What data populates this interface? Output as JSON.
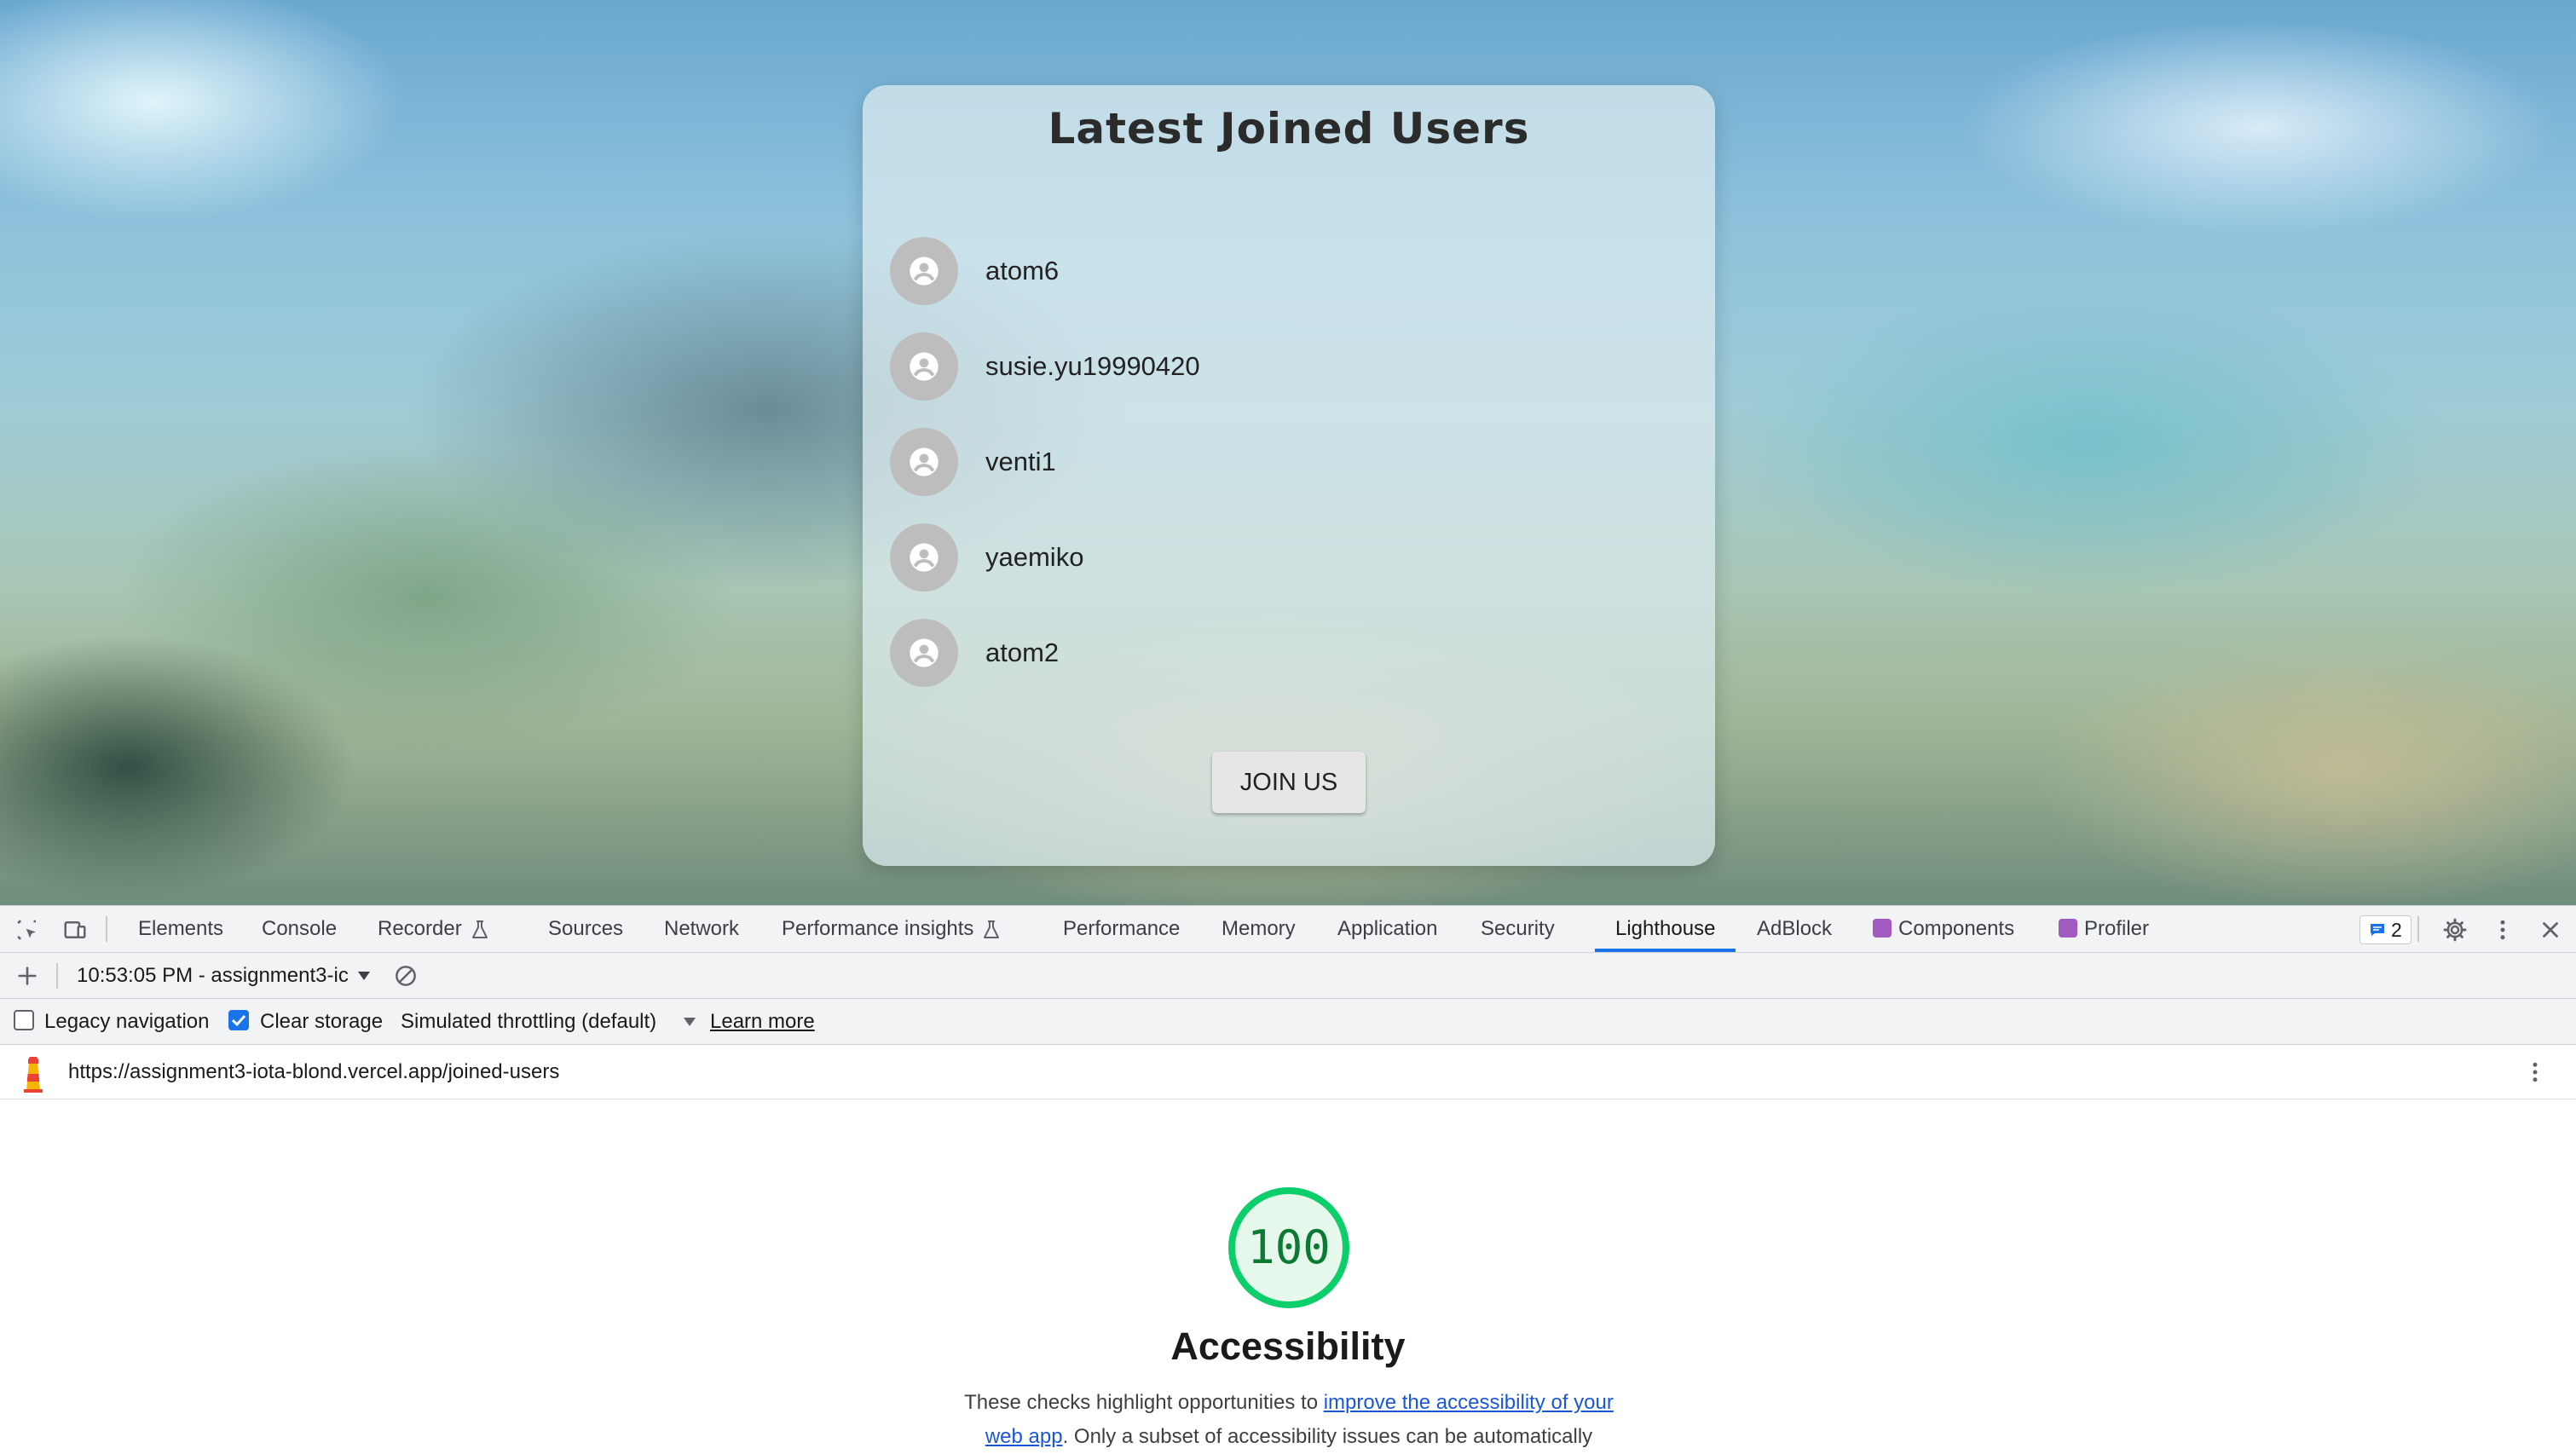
{
  "page": {
    "card": {
      "title": "Latest Joined Users",
      "users": [
        {
          "name": "atom6"
        },
        {
          "name": "susie.yu19990420"
        },
        {
          "name": "venti1"
        },
        {
          "name": "yaemiko"
        },
        {
          "name": "atom2"
        }
      ],
      "join_button": "JOIN US"
    }
  },
  "devtools": {
    "tabs": [
      {
        "label": "Elements"
      },
      {
        "label": "Console"
      },
      {
        "label": "Recorder",
        "icon": "flask-icon"
      },
      {
        "label": "Sources"
      },
      {
        "label": "Network"
      },
      {
        "label": "Performance insights",
        "icon": "flask-icon"
      },
      {
        "label": "Performance"
      },
      {
        "label": "Memory"
      },
      {
        "label": "Application"
      },
      {
        "label": "Security"
      },
      {
        "label": "Lighthouse",
        "active": true
      },
      {
        "label": "AdBlock"
      },
      {
        "label": "Components",
        "icon": "react-extension-icon"
      },
      {
        "label": "Profiler",
        "icon": "react-extension-icon"
      }
    ],
    "issues_count": "2",
    "report_selector": "10:53:05 PM - assignment3-ic",
    "options": {
      "legacy_navigation": {
        "label": "Legacy navigation",
        "checked": false
      },
      "clear_storage": {
        "label": "Clear storage",
        "checked": true
      },
      "throttling": "Simulated throttling (default)",
      "learn_more": "Learn more"
    },
    "url": "https://assignment3-iota-blond.vercel.app/joined-users",
    "report": {
      "score": "100",
      "score_color": "#0cce6b",
      "category": "Accessibility",
      "description_pre": "These checks highlight opportunities to ",
      "description_link": "improve the accessibility of your web app",
      "description_post": ". Only a subset of accessibility issues can be automatically"
    }
  }
}
